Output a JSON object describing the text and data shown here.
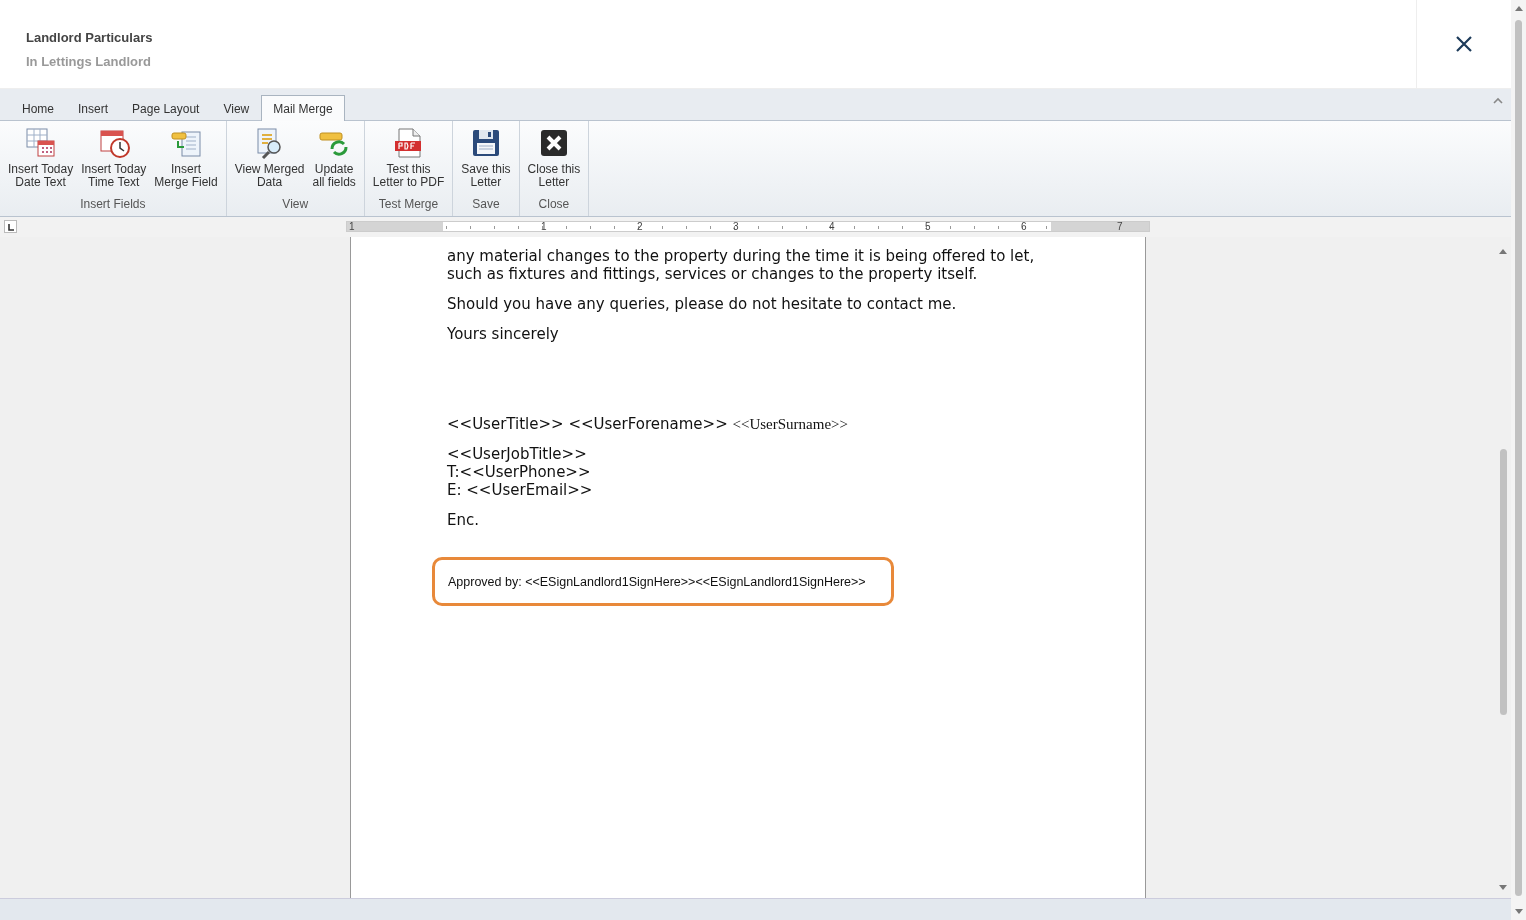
{
  "header": {
    "title": "Landlord Particulars",
    "subtitle": "In Lettings Landlord"
  },
  "ribbon": {
    "tabs": [
      {
        "label": "Home",
        "selected": false
      },
      {
        "label": "Insert",
        "selected": false
      },
      {
        "label": "Page Layout",
        "selected": false
      },
      {
        "label": "View",
        "selected": false
      },
      {
        "label": "Mail Merge",
        "selected": true
      }
    ],
    "groups": [
      {
        "label": "Insert Fields",
        "buttons": [
          {
            "label": "Insert Today\nDate Text"
          },
          {
            "label": "Insert Today\nTime Text"
          },
          {
            "label": "Insert\nMerge Field"
          }
        ]
      },
      {
        "label": "View",
        "buttons": [
          {
            "label": "View Merged\nData"
          },
          {
            "label": "Update\nall fields"
          }
        ]
      },
      {
        "label": "Test Merge",
        "buttons": [
          {
            "label": "Test this\nLetter to PDF"
          }
        ]
      },
      {
        "label": "Save",
        "buttons": [
          {
            "label": "Save this\nLetter"
          }
        ]
      },
      {
        "label": "Close",
        "buttons": [
          {
            "label": "Close this\nLetter"
          }
        ]
      }
    ]
  },
  "ruler": {
    "left_label": "1",
    "labels": [
      "1",
      "2",
      "3",
      "4",
      "5",
      "6",
      "7"
    ]
  },
  "document": {
    "paragraphs": [
      "any material changes to the property during the time it is being offered to let, such as fixtures and fittings, services or changes to the property itself.",
      "Should you have any queries, please do not hesitate to contact me.",
      "Yours sincerely"
    ],
    "name_line": "<<UserTitle>> <<UserForename>>",
    "surname_field": "<<UserSurname>>",
    "contact_lines": [
      "<<UserJobTitle>>",
      "T:<<UserPhone>>",
      "E: <<UserEmail>>"
    ],
    "enclosure": "Enc.",
    "approval": "Approved by: <<ESignLandlord1SignHere>><<ESignLandlord1SignHere>>"
  }
}
